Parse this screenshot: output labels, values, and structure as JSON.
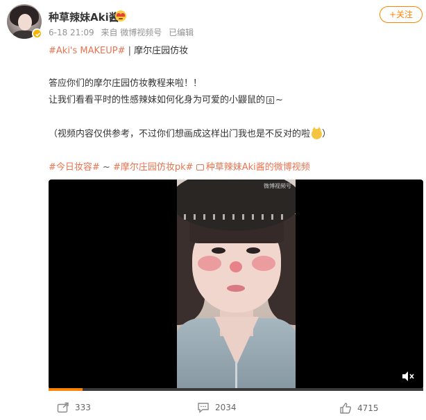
{
  "post": {
    "username": "种草辣妹Aki酱",
    "time": "6-18 21:09",
    "source": "来自 微博视频号",
    "edited": "已编辑",
    "follow_label": "+关注",
    "hashtag1": "#Aki's MAKEUP#",
    "separator": "|",
    "title_text": "摩尔庄园仿妆",
    "body_line1": "答应你们的摩尔庄园仿妆教程来啦！！",
    "body_line2_a": "让我们看看平时的性感辣妹如何化身为可爱的小鼹鼠的",
    "body_line2_box": "8",
    "body_line2_b": "~",
    "body_line3": "（视频内容仅供参考，不过你们想画成这样出门我也是不反对的啦",
    "body_line3_end": "）",
    "topic1": "#今日妆容#",
    "topic_sep": " ~",
    "topic2": "#摩尔庄园仿妆pk#",
    "video_link_text": "种草辣妹Aki酱的微博视频",
    "icons": {
      "verified": "verified-badge-icon",
      "emoji_heart": "heart-eyes-emoji-icon",
      "cat": "cat-emoji-icon",
      "video_link": "video-link-icon",
      "mute": "mute-icon",
      "repost": "repost-icon",
      "comment": "comment-icon",
      "like": "like-icon"
    },
    "accent_color": "#ff8200",
    "topic_color": "#eb7350"
  },
  "video": {
    "watermark": "微博视频号",
    "progress_fraction": 0.09
  },
  "actions": {
    "repost_count": "333",
    "comment_count": "2034",
    "like_count": "4715"
  }
}
